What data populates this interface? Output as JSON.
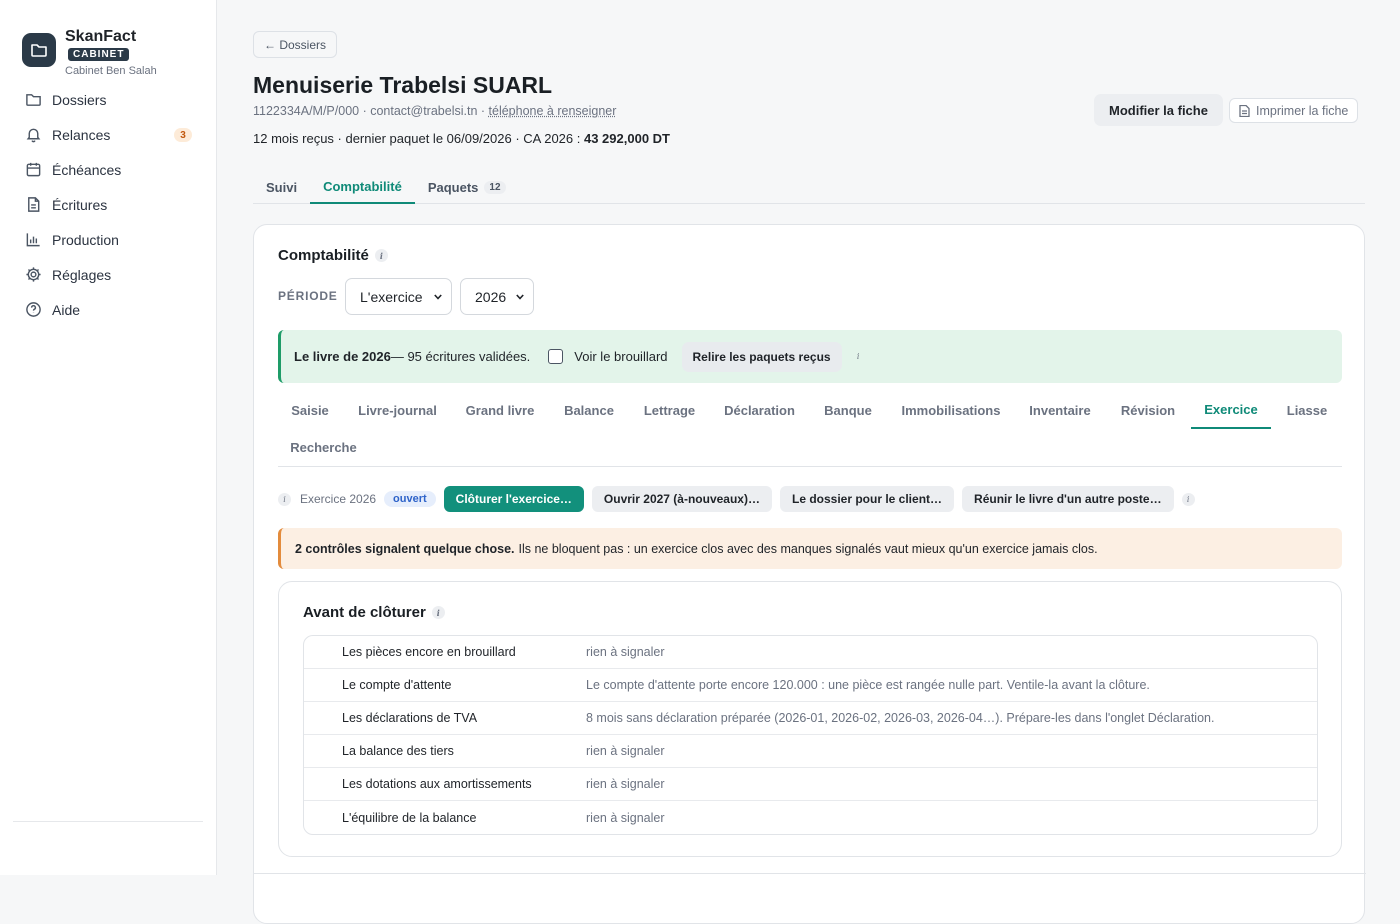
{
  "brand": {
    "name": "SkanFact",
    "badge": "CABINET",
    "subtitle": "Cabinet Ben Salah"
  },
  "nav": {
    "items": [
      {
        "label": "Dossiers",
        "icon": "folder-icon"
      },
      {
        "label": "Relances",
        "icon": "bell-icon",
        "badge": "3"
      },
      {
        "label": "Échéances",
        "icon": "calendar-icon"
      },
      {
        "label": "Écritures",
        "icon": "document-icon"
      },
      {
        "label": "Production",
        "icon": "bar-chart-icon"
      },
      {
        "label": "Réglages",
        "icon": "gear-icon"
      },
      {
        "label": "Aide",
        "icon": "help-circle-icon"
      }
    ]
  },
  "header": {
    "back_label": "← Dossiers",
    "title": "Menuiserie Trabelsi SUARL",
    "tax_id": "1122334A/M/P/000",
    "sep": " · ",
    "email": "contact@trabelsi.tn",
    "phone_placeholder": "téléphone à renseigner",
    "stats_prefix": "12 mois reçus · dernier paquet le 06/09/2026 · CA 2026 : ",
    "stats_amount": "43 292,000 DT",
    "edit_label": "Modifier la fiche",
    "print_label": "Imprimer la fiche"
  },
  "top_tabs": [
    {
      "label": "Suivi"
    },
    {
      "label": "Comptabilité",
      "active": true
    },
    {
      "label": "Paquets",
      "count": "12"
    }
  ],
  "compta": {
    "title": "Comptabilité",
    "info": "i",
    "period_label": "PÉRIODE",
    "period_value": "L'exercice",
    "year_value": "2026",
    "ledger_bold": "Le livre de 2026",
    "ledger_rest": " — 95 écritures validées.",
    "draft_label": "Voir le brouillard",
    "reread_label": "Relire les paquets reçus"
  },
  "sub_tabs": [
    {
      "label": "Saisie"
    },
    {
      "label": "Livre-journal"
    },
    {
      "label": "Grand livre"
    },
    {
      "label": "Balance"
    },
    {
      "label": "Lettrage"
    },
    {
      "label": "Déclaration"
    },
    {
      "label": "Banque"
    },
    {
      "label": "Immobilisations"
    },
    {
      "label": "Inventaire"
    },
    {
      "label": "Révision"
    },
    {
      "label": "Exercice",
      "active": true
    },
    {
      "label": "Liasse"
    },
    {
      "label": "Recherche"
    }
  ],
  "exercise": {
    "label": "Exercice 2026",
    "status": "ouvert",
    "close_label": "Clôturer l'exercice…",
    "open_next_label": "Ouvrir 2027 (à-nouveaux)…",
    "client_file_label": "Le dossier pour le client…",
    "merge_label": "Réunir le livre d'un autre poste…"
  },
  "warning": {
    "bold": "2 contrôles signalent quelque chose.",
    "rest": "Ils ne bloquent pas : un exercice clos avec des manques signalés vaut mieux qu'un exercice jamais clos."
  },
  "checks": {
    "title": "Avant de clôturer",
    "rows": [
      {
        "name": "Les pièces encore en brouillard",
        "message": "rien à signaler"
      },
      {
        "name": "Le compte d'attente",
        "message": "Le compte d'attente porte encore 120.000 : une pièce est rangée nulle part. Ventile-la avant la clôture."
      },
      {
        "name": "Les déclarations de TVA",
        "message": "8 mois sans déclaration préparée (2026-01, 2026-02, 2026-03, 2026-04…). Prépare-les dans l'onglet Déclaration."
      },
      {
        "name": "La balance des tiers",
        "message": "rien à signaler"
      },
      {
        "name": "Les dotations aux amortissements",
        "message": "rien à signaler"
      },
      {
        "name": "L'équilibre de la balance",
        "message": "rien à signaler"
      }
    ]
  },
  "colors": {
    "accent": "#0f8a78",
    "success_bg": "#e3f4ea",
    "warning_bg": "#fcefe3",
    "sidebar_dark": "#2b3a48"
  }
}
